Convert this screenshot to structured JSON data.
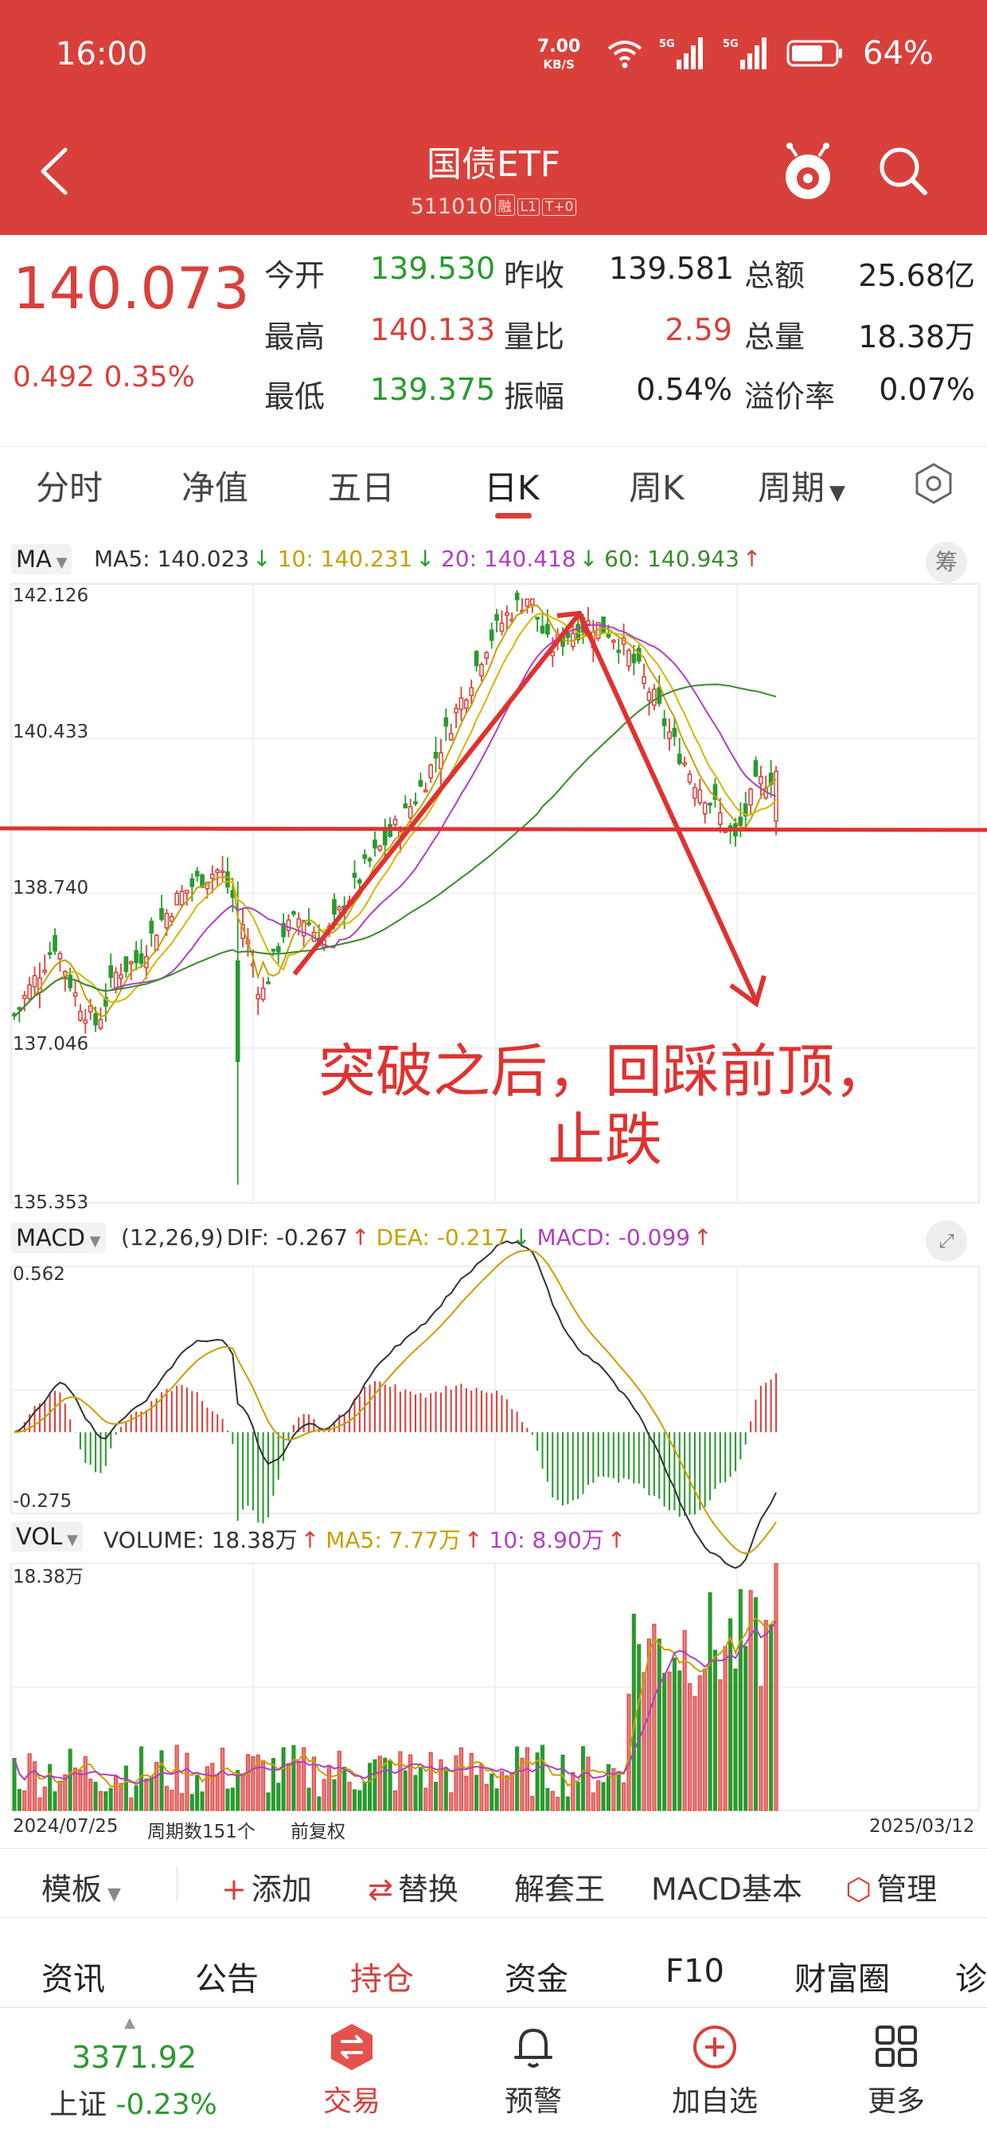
{
  "status_bar": {
    "time": "16:00",
    "net_speed": "7.00",
    "net_unit": "KB/S",
    "battery": "64%"
  },
  "header": {
    "title": "国债ETF",
    "code": "511010",
    "tags": [
      "融",
      "L1",
      "T+0"
    ]
  },
  "quote": {
    "last": "140.073",
    "change": "0.492",
    "change_pct": "0.35%",
    "rows": [
      [
        {
          "label": "今开",
          "value": "139.530",
          "c": "green"
        },
        {
          "label": "昨收",
          "value": "139.581",
          "c": "blk"
        },
        {
          "label": "总额",
          "value": "25.68亿",
          "c": "blk"
        }
      ],
      [
        {
          "label": "最高",
          "value": "140.133",
          "c": "red"
        },
        {
          "label": "量比",
          "value": "2.59",
          "c": "red"
        },
        {
          "label": "总量",
          "value": "18.38万",
          "c": "blk"
        }
      ],
      [
        {
          "label": "最低",
          "value": "139.375",
          "c": "green"
        },
        {
          "label": "振幅",
          "value": "0.54%",
          "c": "blk"
        },
        {
          "label": "溢价率",
          "value": "0.07%",
          "c": "blk"
        }
      ]
    ]
  },
  "tabs": [
    "分时",
    "净值",
    "五日",
    "日K",
    "周K",
    "周期"
  ],
  "active_tab": "日K",
  "ma_legend": {
    "selector": "MA",
    "ma5": "MA5: 140.023",
    "ma10": "10: 140.231",
    "ma20": "20: 140.418",
    "ma60": "60: 140.943",
    "chip_button": "筹"
  },
  "macd_legend": {
    "selector": "MACD",
    "params": "(12,26,9)",
    "dif": "DIF: -0.267",
    "dea": "DEA: -0.217",
    "macd": "MACD: -0.099"
  },
  "vol_legend": {
    "selector": "VOL",
    "volume": "VOLUME: 18.38万",
    "ma5": "MA5: 7.77万",
    "ma10": "10: 8.90万"
  },
  "annotation": {
    "line1": "突破之后，回踩前顶，",
    "line2": "止跌"
  },
  "footer_axis": {
    "start_date": "2024/07/25",
    "periods": "周期数151个",
    "adjust": "前复权",
    "end_date": "2025/03/12"
  },
  "chart_data": [
    {
      "type": "candlestick",
      "title": "",
      "ylim": [
        135.353,
        142.126
      ],
      "y_ticks": [
        "142.126",
        "140.433",
        "138.740",
        "137.046",
        "135.353"
      ],
      "x_range": [
        "2024/07/25",
        "2025/03/12"
      ],
      "period_count": 151,
      "close_path": [
        137.4,
        137.8,
        138.2,
        137.6,
        137.3,
        137.9,
        138.0,
        138.4,
        138.7,
        138.9,
        139.0,
        138.5,
        137.6,
        138.3,
        138.5,
        138.2,
        138.6,
        139.0,
        139.3,
        139.6,
        140.0,
        140.5,
        141.0,
        141.5,
        141.8,
        142.0,
        141.4,
        141.6,
        141.7,
        141.6,
        141.3,
        140.9,
        140.4,
        140.0,
        139.7,
        139.3,
        139.9,
        140.07
      ],
      "ma_series": [
        {
          "name": "MA5",
          "last": 140.023,
          "color": "#c8a000"
        },
        {
          "name": "MA10",
          "last": 140.231,
          "color": "#d4b800"
        },
        {
          "name": "MA20",
          "last": 140.418,
          "color": "#b040c0"
        },
        {
          "name": "MA60",
          "last": 140.943,
          "color": "#3a8a2a"
        }
      ],
      "support_level": 139.45
    },
    {
      "type": "bar",
      "title": "",
      "y_ticks": [
        "0.562",
        "-0.275"
      ],
      "ylim": [
        -0.275,
        0.562
      ],
      "last": {
        "DIF": -0.267,
        "DEA": -0.217,
        "MACD": -0.099
      }
    },
    {
      "type": "bar",
      "title": "",
      "y_ticks": [
        "18.38万"
      ],
      "last": {
        "VOLUME": "18.38万",
        "MA5": "7.77万",
        "MA10": "8.90万"
      }
    }
  ],
  "toolbar": [
    "模板",
    "添加",
    "替换",
    "解套王",
    "MACD基本",
    "管理"
  ],
  "news_tabs": [
    "资讯",
    "公告",
    "持仓",
    "资金",
    "F10",
    "财富圈",
    "诊"
  ],
  "news_active": "持仓",
  "bottom_bar": {
    "index_value": "3371.92",
    "index_name": "上证",
    "index_change": "-0.23%",
    "nav": [
      "交易",
      "预警",
      "加自选",
      "更多"
    ]
  }
}
